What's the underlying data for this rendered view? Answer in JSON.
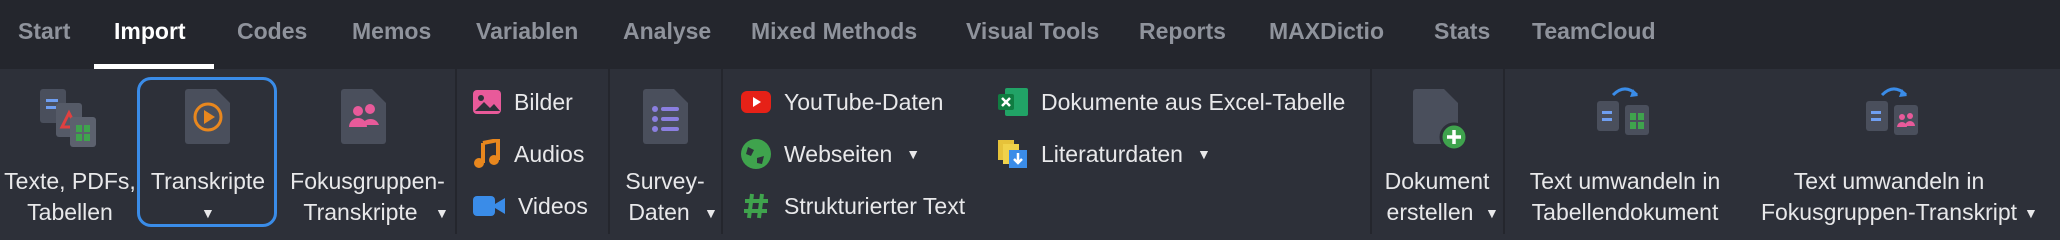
{
  "tabs": [
    {
      "label": "Start"
    },
    {
      "label": "Import"
    },
    {
      "label": "Codes"
    },
    {
      "label": "Memos"
    },
    {
      "label": "Variablen"
    },
    {
      "label": "Analyse"
    },
    {
      "label": "Mixed Methods"
    },
    {
      "label": "Visual Tools"
    },
    {
      "label": "Reports"
    },
    {
      "label": "MAXDictio"
    },
    {
      "label": "Stats"
    },
    {
      "label": "TeamCloud"
    }
  ],
  "active_tab": "Import",
  "ribbon": {
    "texte": {
      "line1": "Texte, PDFs,",
      "line2": "Tabellen"
    },
    "transkripte": {
      "line1": "Transkripte"
    },
    "fokus": {
      "line1": "Fokusgruppen-",
      "line2": "Transkripte"
    },
    "bilder": "Bilder",
    "audios": "Audios",
    "videos": "Videos",
    "survey": {
      "line1": "Survey-",
      "line2": "Daten"
    },
    "youtube": "YouTube-Daten",
    "webseiten": "Webseiten",
    "strukturiert": "Strukturierter Text",
    "excel": "Dokumente aus Excel-Tabelle",
    "literatur": "Literaturdaten",
    "dokument": {
      "line1": "Dokument",
      "line2": "erstellen"
    },
    "umwandeln_tabelle": {
      "line1": "Text umwandeln in",
      "line2": "Tabellendokument"
    },
    "umwandeln_fokus": {
      "line1": "Text umwandeln in",
      "line2": "Fokusgruppen-Transkript"
    }
  },
  "colors": {
    "accent_blue": "#3a8ce8",
    "youtube_red": "#e62117",
    "green": "#3fa34d",
    "orange": "#e8871e",
    "pink": "#e85a9a",
    "purple": "#8b7fe0"
  }
}
